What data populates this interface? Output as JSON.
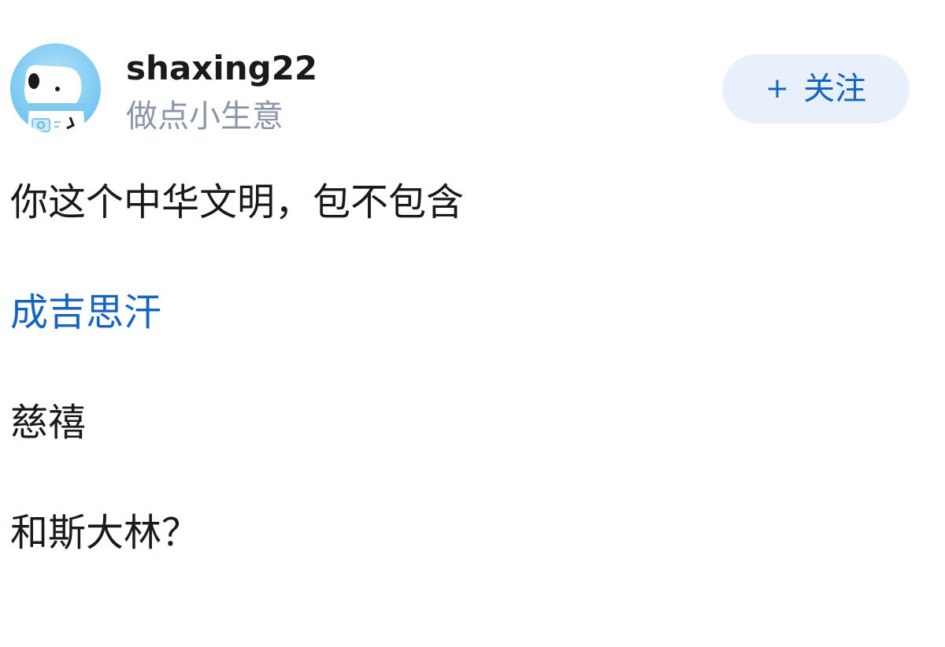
{
  "author": {
    "username": "shaxing22",
    "bio": "做点小生意",
    "avatar_icon": "polar-bear-avatar"
  },
  "follow_button": {
    "plus": "+",
    "label": "关注"
  },
  "post": {
    "lines": [
      "你这个中华文明，包不包含",
      "成吉思汗",
      "慈禧",
      "和斯大林？"
    ]
  },
  "colors": {
    "link": "#1565c0",
    "bio": "#8c96a8",
    "follow_bg": "#e8f1fb",
    "text": "#1a1a1a"
  }
}
